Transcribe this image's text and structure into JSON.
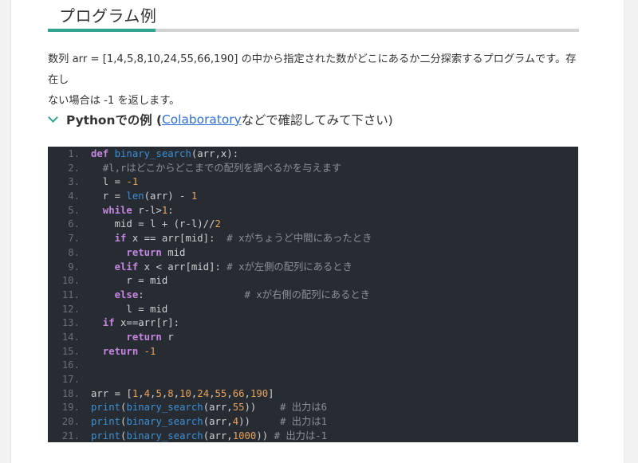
{
  "section": {
    "title": "プログラム例"
  },
  "description": {
    "line1": "数列 arr = [1,4,5,8,10,24,55,66,190] の中から指定された数がどこにあるか二分探索するプログラムです。存在し",
    "line2": "ない場合は -1 を返します。"
  },
  "example_header": {
    "prefix": "Pythonでの例 (",
    "link_text": "Colaboratory",
    "suffix": " などで確認してみて下さい)"
  },
  "code": {
    "language": "python",
    "lines": [
      {
        "n": "1.",
        "tokens": [
          [
            "kw",
            "def "
          ],
          [
            "fn",
            "binary_search"
          ],
          [
            "op",
            "(arr,x):"
          ]
        ]
      },
      {
        "n": "2.",
        "tokens": [
          [
            "cm",
            "  #l,rはどこからどこまでの配列を調べるかを与えます"
          ]
        ]
      },
      {
        "n": "3.",
        "tokens": [
          [
            "op",
            "  l = "
          ],
          [
            "num",
            "-1"
          ]
        ]
      },
      {
        "n": "4.",
        "tokens": [
          [
            "op",
            "  r = "
          ],
          [
            "fn",
            "len"
          ],
          [
            "op",
            "(arr) - "
          ],
          [
            "num",
            "1"
          ]
        ]
      },
      {
        "n": "5.",
        "tokens": [
          [
            "kw",
            "  while "
          ],
          [
            "op",
            "r-l>"
          ],
          [
            "num",
            "1"
          ],
          [
            "op",
            ":"
          ]
        ]
      },
      {
        "n": "6.",
        "tokens": [
          [
            "op",
            "    mid = l + (r-l)//"
          ],
          [
            "num",
            "2"
          ]
        ]
      },
      {
        "n": "7.",
        "tokens": [
          [
            "kw",
            "    if "
          ],
          [
            "op",
            "x == arr[mid]:  "
          ],
          [
            "cm",
            "# xがちょうど中間にあったとき"
          ]
        ]
      },
      {
        "n": "8.",
        "tokens": [
          [
            "kw",
            "      return "
          ],
          [
            "op",
            "mid"
          ]
        ]
      },
      {
        "n": "9.",
        "tokens": [
          [
            "kw",
            "    elif "
          ],
          [
            "op",
            "x < arr[mid]: "
          ],
          [
            "cm",
            "# xが左側の配列にあるとき"
          ]
        ]
      },
      {
        "n": "10.",
        "tokens": [
          [
            "op",
            "      r = mid"
          ]
        ]
      },
      {
        "n": "11.",
        "tokens": [
          [
            "kw",
            "    else"
          ],
          [
            "op",
            ":                 "
          ],
          [
            "cm",
            "# xが右側の配列にあるとき"
          ]
        ]
      },
      {
        "n": "12.",
        "tokens": [
          [
            "op",
            "      l = mid"
          ]
        ]
      },
      {
        "n": "13.",
        "tokens": [
          [
            "kw",
            "  if "
          ],
          [
            "op",
            "x==arr[r]:"
          ]
        ]
      },
      {
        "n": "14.",
        "tokens": [
          [
            "kw",
            "      return "
          ],
          [
            "op",
            "r"
          ]
        ]
      },
      {
        "n": "15.",
        "tokens": [
          [
            "kw",
            "  return "
          ],
          [
            "num",
            "-1"
          ]
        ]
      },
      {
        "n": "16.",
        "tokens": []
      },
      {
        "n": "17.",
        "tokens": []
      },
      {
        "n": "18.",
        "tokens": [
          [
            "op",
            "arr = ["
          ],
          [
            "num",
            "1"
          ],
          [
            "op",
            ","
          ],
          [
            "num",
            "4"
          ],
          [
            "op",
            ","
          ],
          [
            "num",
            "5"
          ],
          [
            "op",
            ","
          ],
          [
            "num",
            "8"
          ],
          [
            "op",
            ","
          ],
          [
            "num",
            "10"
          ],
          [
            "op",
            ","
          ],
          [
            "num",
            "24"
          ],
          [
            "op",
            ","
          ],
          [
            "num",
            "55"
          ],
          [
            "op",
            ","
          ],
          [
            "num",
            "66"
          ],
          [
            "op",
            ","
          ],
          [
            "num",
            "190"
          ],
          [
            "op",
            "]"
          ]
        ]
      },
      {
        "n": "19.",
        "tokens": [
          [
            "fn",
            "print"
          ],
          [
            "op",
            "("
          ],
          [
            "fn",
            "binary_search"
          ],
          [
            "op",
            "(arr,"
          ],
          [
            "num",
            "55"
          ],
          [
            "op",
            "))    "
          ],
          [
            "cm",
            "# 出力は6"
          ]
        ]
      },
      {
        "n": "20.",
        "tokens": [
          [
            "fn",
            "print"
          ],
          [
            "op",
            "("
          ],
          [
            "fn",
            "binary_search"
          ],
          [
            "op",
            "(arr,"
          ],
          [
            "num",
            "4"
          ],
          [
            "op",
            "))     "
          ],
          [
            "cm",
            "# 出力は1"
          ]
        ]
      },
      {
        "n": "21.",
        "tokens": [
          [
            "fn",
            "print"
          ],
          [
            "op",
            "("
          ],
          [
            "fn",
            "binary_search"
          ],
          [
            "op",
            "(arr,"
          ],
          [
            "num",
            "1000"
          ],
          [
            "op",
            ")) "
          ],
          [
            "cm",
            "# 出力は-1"
          ]
        ]
      }
    ]
  },
  "colors": {
    "accent": "#2fa38f",
    "link": "#2f6fd8",
    "code_bg": "#272c33"
  }
}
